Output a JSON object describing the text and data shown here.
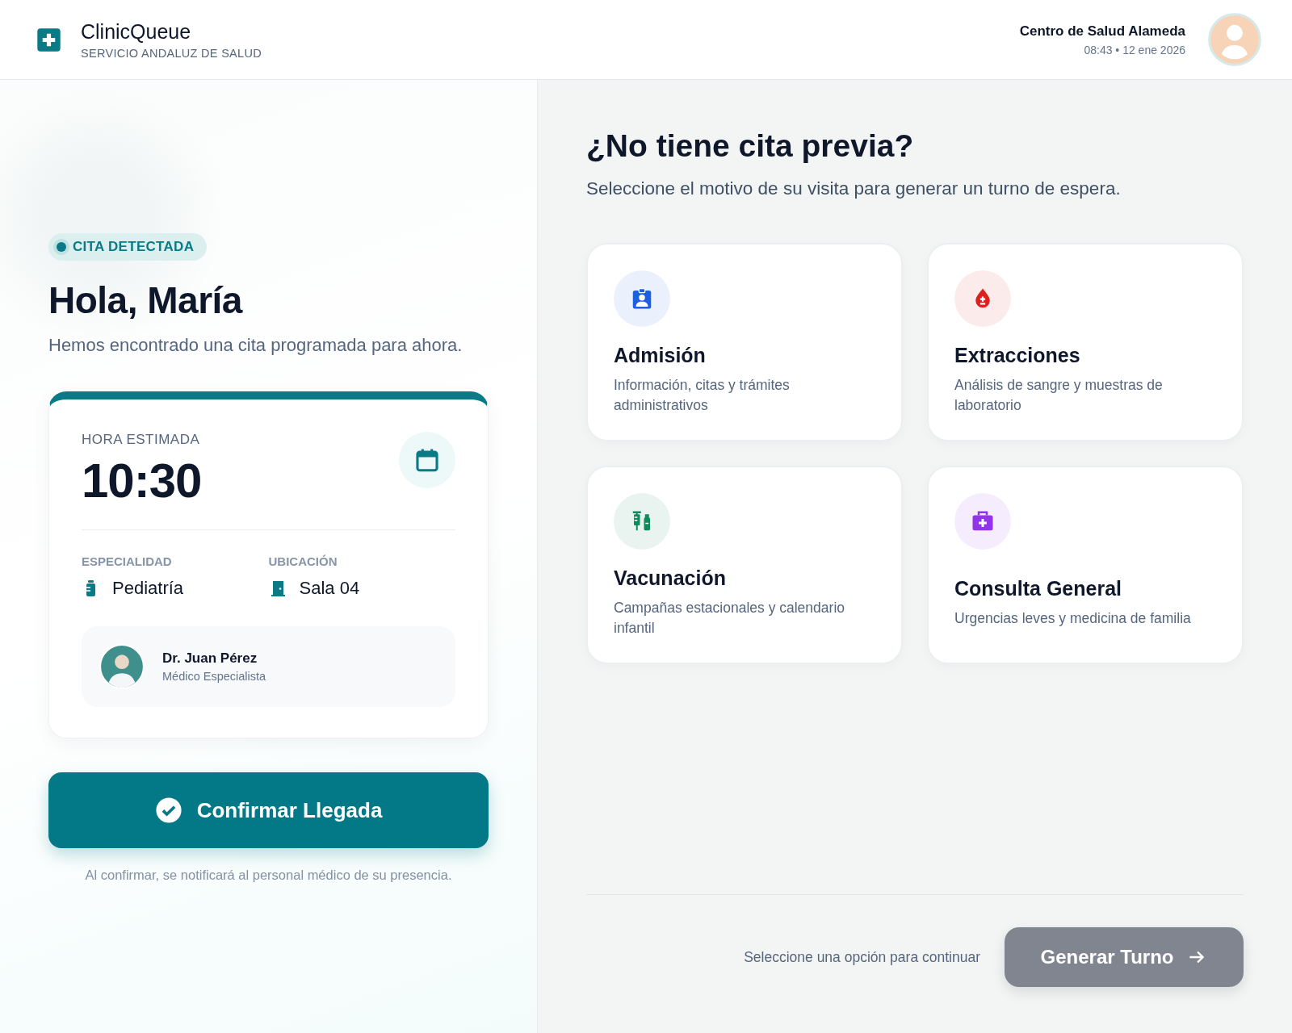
{
  "header": {
    "app_name": "ClinicQueue",
    "organization": "SERVICIO ANDALUZ DE SALUD",
    "center_name": "Centro de Salud Alameda",
    "datetime": "08:43 • 12 ene 2026"
  },
  "appointment": {
    "badge": "CITA DETECTADA",
    "greeting": "Hola, María",
    "message": "Hemos encontrado una cita programada para ahora.",
    "time_label": "HORA ESTIMADA",
    "time": "10:30",
    "details": [
      {
        "label": "ESPECIALIDAD",
        "value": "Pediatría",
        "kind": "bottle"
      },
      {
        "label": "UBICACIÓN",
        "value": "Sala 04",
        "kind": "door"
      }
    ],
    "doctor": {
      "name": "Dr. Juan Pérez",
      "role": "Médico Especialista"
    },
    "confirm_button": "Confirmar Llegada",
    "note": "Al confirmar, se notificará al personal médico de su presencia."
  },
  "walk_in": {
    "title": "¿No tiene cita previa?",
    "subtitle": "Seleccione el motivo de su visita para generar un turno de espera.",
    "services": [
      {
        "title": "Admisión",
        "description": "Información, citas y trámites administrativos",
        "kind": "idcard",
        "color": "#1d5fe0",
        "selected": false
      },
      {
        "title": "Extracciones",
        "description": "Análisis de sangre y muestras de laboratorio",
        "kind": "blood",
        "color": "#dc1f1f",
        "selected": false
      },
      {
        "title": "Vacunación",
        "description": "Campañas estacionales y calendario infantil",
        "kind": "vaccine",
        "color": "#0f8a5a",
        "selected": false
      },
      {
        "title": "Consulta General",
        "description": "Urgencias leves y medicina de familia",
        "kind": "medkit",
        "color": "#9333ea",
        "selected": false
      }
    ],
    "hint": "Seleccione una opción para continuar",
    "generate_button": {
      "label": "Generar Turno",
      "disabled": true
    }
  }
}
